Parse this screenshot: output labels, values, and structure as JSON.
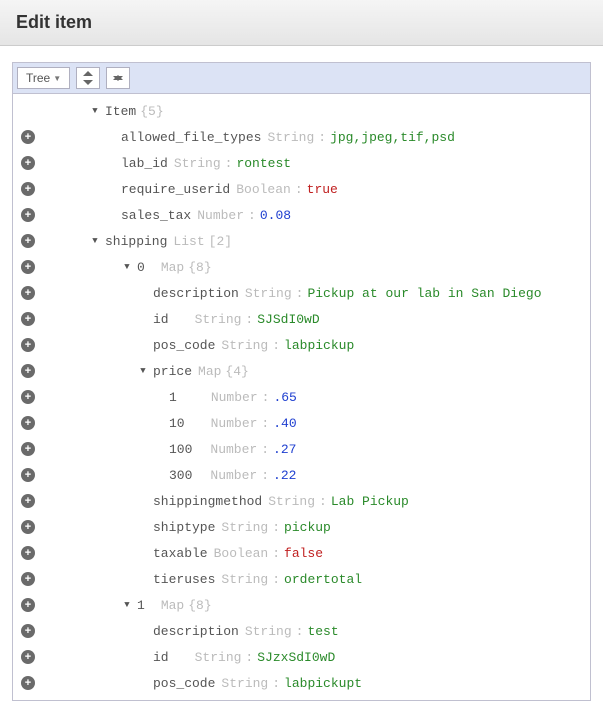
{
  "header": {
    "title": "Edit item"
  },
  "toolbar": {
    "tree_label": "Tree"
  },
  "root": {
    "key": "Item",
    "count": "{5}"
  },
  "fields": {
    "allowed_file_types": {
      "key": "allowed_file_types",
      "type": "String",
      "value": "jpg,jpeg,tif,psd"
    },
    "lab_id": {
      "key": "lab_id",
      "type": "String",
      "value": "rontest"
    },
    "require_userid": {
      "key": "require_userid",
      "type": "Boolean",
      "value": "true"
    },
    "sales_tax": {
      "key": "sales_tax",
      "type": "Number",
      "value": "0.08"
    },
    "shipping": {
      "key": "shipping",
      "type": "List",
      "count": "[2]"
    }
  },
  "shipping0": {
    "key": "0",
    "type": "Map",
    "count": "{8}",
    "description": {
      "key": "description",
      "type": "String",
      "value": "Pickup at our lab in San Diego"
    },
    "id": {
      "key": "id",
      "type": "String",
      "value": "SJSdI0wD"
    },
    "pos_code": {
      "key": "pos_code",
      "type": "String",
      "value": "labpickup"
    },
    "price": {
      "key": "price",
      "type": "Map",
      "count": "{4}",
      "t1": {
        "key": "1",
        "type": "Number",
        "value": ".65"
      },
      "t10": {
        "key": "10",
        "type": "Number",
        "value": ".40"
      },
      "t100": {
        "key": "100",
        "type": "Number",
        "value": ".27"
      },
      "t300": {
        "key": "300",
        "type": "Number",
        "value": ".22"
      }
    },
    "shippingmethod": {
      "key": "shippingmethod",
      "type": "String",
      "value": "Lab Pickup"
    },
    "shiptype": {
      "key": "shiptype",
      "type": "String",
      "value": "pickup"
    },
    "taxable": {
      "key": "taxable",
      "type": "Boolean",
      "value": "false"
    },
    "tieruses": {
      "key": "tieruses",
      "type": "String",
      "value": "ordertotal"
    }
  },
  "shipping1": {
    "key": "1",
    "type": "Map",
    "count": "{8}",
    "description": {
      "key": "description",
      "type": "String",
      "value": "test"
    },
    "id": {
      "key": "id",
      "type": "String",
      "value": "SJzxSdI0wD"
    },
    "pos_code": {
      "key": "pos_code",
      "type": "String",
      "value": "labpickupt"
    }
  }
}
